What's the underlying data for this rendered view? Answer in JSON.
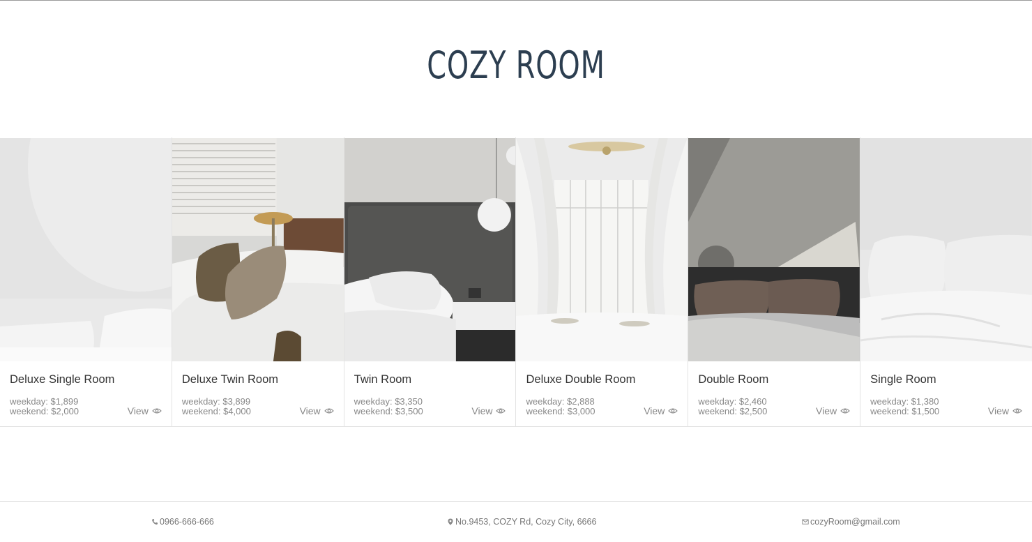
{
  "site": {
    "title": "COZY ROOM"
  },
  "rooms": [
    {
      "name": "Deluxe Single Room",
      "weekday": "weekday: $1,899",
      "weekend": "weekend: $2,000",
      "view_label": "View"
    },
    {
      "name": "Deluxe Twin Room",
      "weekday": "weekday: $3,899",
      "weekend": "weekend: $4,000",
      "view_label": "View"
    },
    {
      "name": "Twin Room",
      "weekday": "weekday: $3,350",
      "weekend": "weekend: $3,500",
      "view_label": "View"
    },
    {
      "name": "Deluxe Double Room",
      "weekday": "weekday: $2,888",
      "weekend": "weekend: $3,000",
      "view_label": "View"
    },
    {
      "name": "Double Room",
      "weekday": "weekday: $2,460",
      "weekend": "weekend: $2,500",
      "view_label": "View"
    },
    {
      "name": "Single Room",
      "weekday": "weekday: $1,380",
      "weekend": "weekend: $1,500",
      "view_label": "View"
    }
  ],
  "footer": {
    "phone": "0966-666-666",
    "address": "No.9453, COZY Rd, Cozy City, 6666",
    "email": "cozyRoom@gmail.com"
  },
  "colors": {
    "title": "#2c3e50",
    "muted_text": "#888888",
    "room_name": "#333333"
  },
  "icons": {
    "view": "eye-icon",
    "phone": "phone-icon",
    "address": "map-pin-icon",
    "email": "envelope-icon"
  }
}
